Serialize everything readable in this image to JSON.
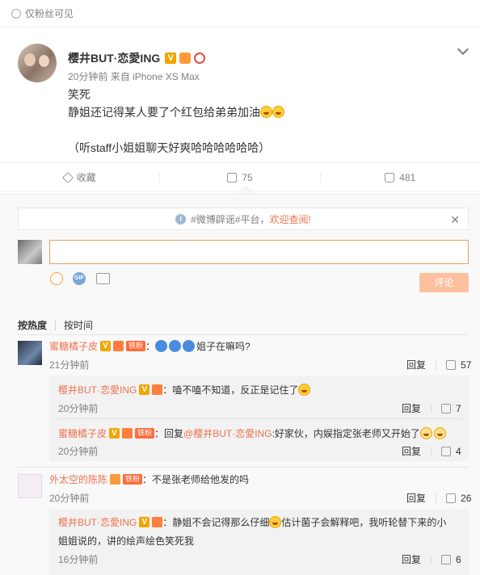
{
  "visibility": {
    "label": "仅粉丝可见"
  },
  "post": {
    "author": "樱井BUT·恋愛ING",
    "time": "20分钟前",
    "source": "来自 iPhone XS Max",
    "lines": [
      "笑死",
      "静姐还记得某人要了个红包给弟弟加油",
      "",
      "（听staff小姐姐聊天好爽哈哈哈哈哈哈）"
    ]
  },
  "actions": {
    "favorite": "收藏",
    "comments": "75",
    "likes": "481"
  },
  "notice": {
    "prefix": "#微博辟谣#平台，",
    "link": "欢迎查阅!",
    "close": "✕"
  },
  "composer": {
    "input_value": "",
    "submit": "评论"
  },
  "sort": {
    "hot": "按热度",
    "time": "按时间"
  },
  "comments": [
    {
      "author": "蜜糖橘子皮",
      "badge": "铁粉",
      "text": "姐子在嘛吗?",
      "time": "21分钟前",
      "reply": "回复",
      "likes": "57"
    },
    {
      "author": "樱井BUT·恋愛ING",
      "text": "：嗑不嗑不知道，反正是记住了",
      "time": "20分钟前",
      "reply": "回复",
      "likes": "7"
    },
    {
      "author": "蜜糖橘子皮",
      "badge": "铁粉",
      "text_pre": "：回复",
      "mention": "@樱井BUT·恋愛ING",
      "text_post": ":好家伙，内娱指定张老师又开始了",
      "time": "20分钟前",
      "reply": "回复",
      "likes": "4"
    },
    {
      "author": "外太空的陈陈",
      "badge": "铁粉",
      "text": "：不是张老师给他发的吗",
      "time": "20分钟前",
      "reply": "回复",
      "likes": "26"
    },
    {
      "author": "樱井BUT·恋愛ING",
      "text_line1": "：静姐不会记得那么仔细",
      "text_line1b": "估计菌子会解释吧，我听轮替下来的小",
      "text_line2": "姐姐说的，讲的绘声绘色笑死我",
      "time": "16分钟前",
      "reply": "回复",
      "likes": "6"
    }
  ]
}
